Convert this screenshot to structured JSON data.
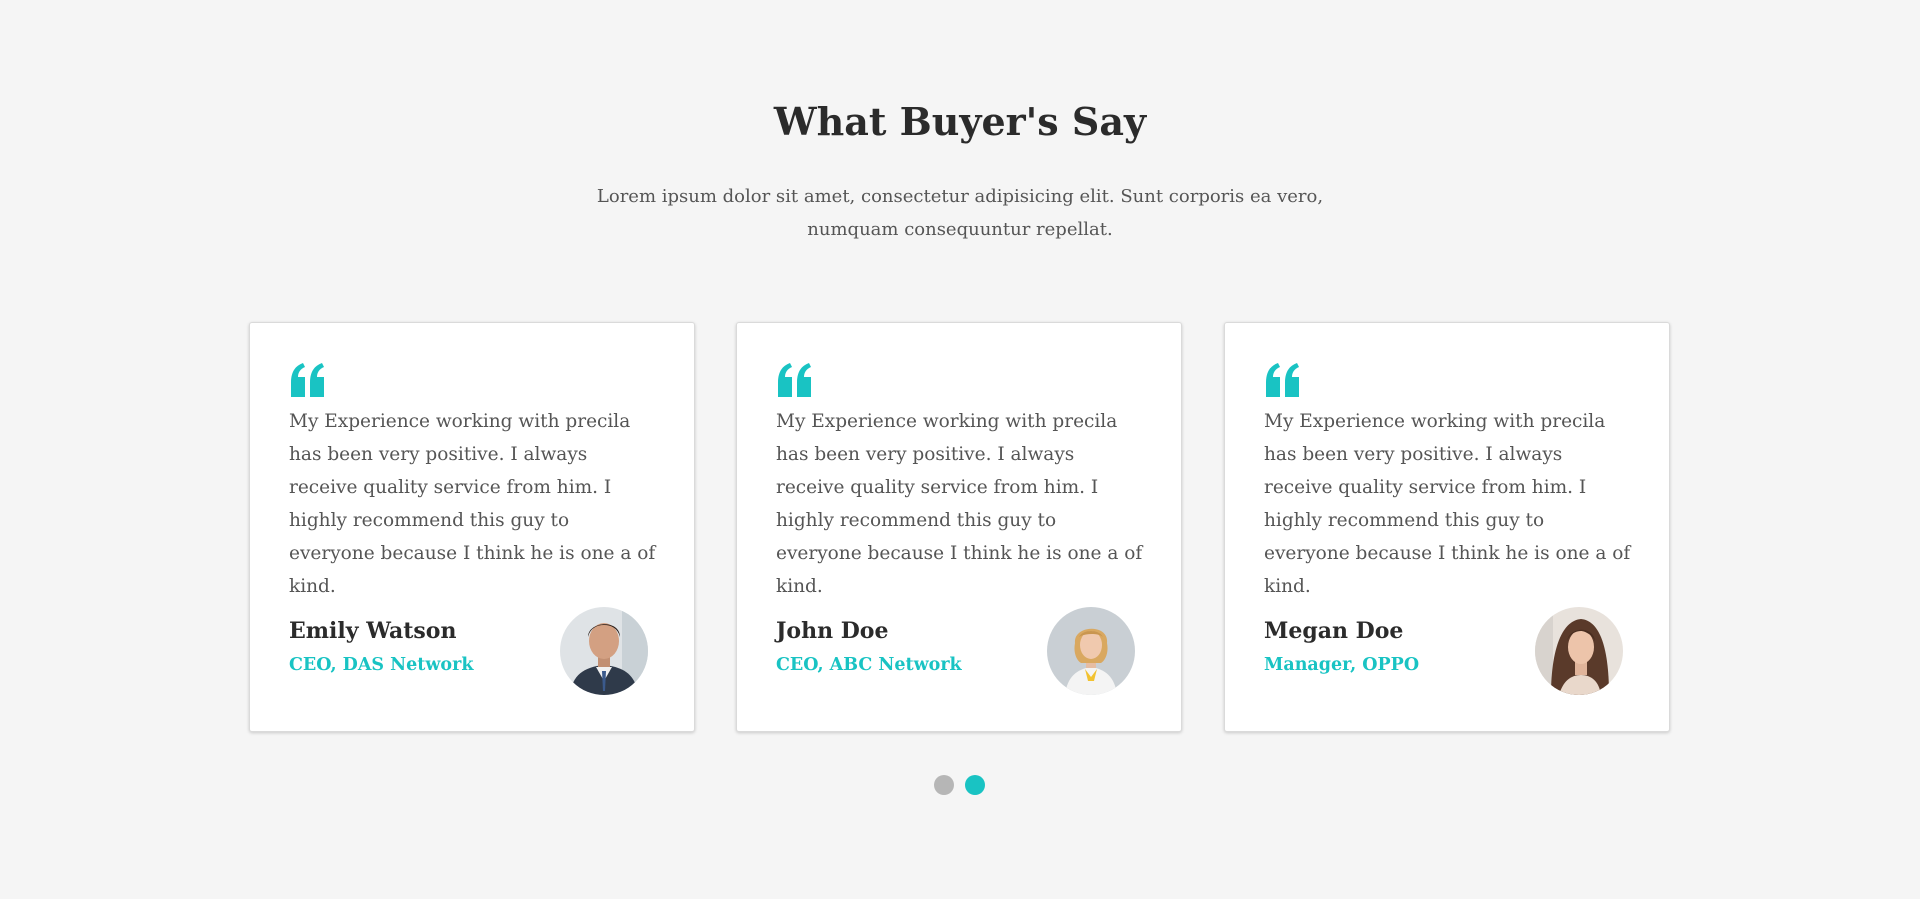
{
  "section": {
    "title": "What Buyer's Say",
    "subtitle_line1": "Lorem ipsum dolor sit amet, consectetur adipisicing elit. Sunt corporis ea vero,",
    "subtitle_line2": "numquam consequuntur repellat."
  },
  "colors": {
    "accent": "#19c3c3",
    "background": "#f5f5f5",
    "card": "#ffffff",
    "dot_inactive": "#b6b6b6"
  },
  "testimonials": [
    {
      "icon": "quote-icon",
      "text": "My Experience working with precila has been very positive. I always receive quality service from him. I highly recommend this guy to everyone because I think he is one a of kind.",
      "name": "Emily Watson",
      "role": "CEO, DAS Network",
      "avatar": "avatar-man-suit"
    },
    {
      "icon": "quote-icon",
      "text": "My Experience working with precila has been very positive. I always receive quality service from him. I highly recommend this guy to everyone because I think he is one a of kind.",
      "name": "John Doe",
      "role": "CEO, ABC Network",
      "avatar": "avatar-woman-blonde"
    },
    {
      "icon": "quote-icon",
      "text": "My Experience working with precila has been very positive. I always receive quality service from him. I highly recommend this guy to everyone because I think he is one a of kind.",
      "name": "Megan Doe",
      "role": "Manager, OPPO",
      "avatar": "avatar-woman-brunette"
    }
  ],
  "pagination": {
    "pages": 2,
    "active_page": 2
  }
}
